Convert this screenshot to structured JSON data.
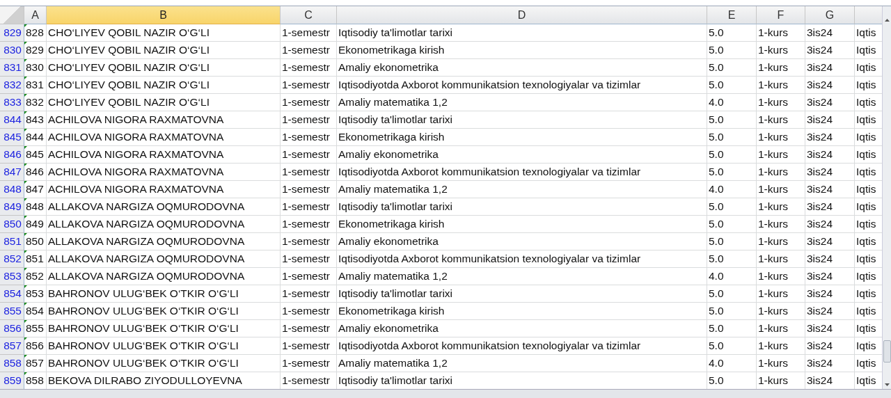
{
  "columns": [
    {
      "label": "A",
      "selected": false
    },
    {
      "label": "B",
      "selected": true
    },
    {
      "label": "C",
      "selected": false
    },
    {
      "label": "D",
      "selected": false
    },
    {
      "label": "E",
      "selected": false
    },
    {
      "label": "F",
      "selected": false
    },
    {
      "label": "G",
      "selected": false
    },
    {
      "selected": false
    }
  ],
  "rows": [
    {
      "row": "829",
      "cells": [
        "828",
        "CHO‘LIYEV QOBIL NAZIR O‘G‘LI",
        "1-semestr",
        "Iqtisodiy ta'limotlar tarixi",
        "5.0",
        "1-kurs",
        "3is24",
        "Iqtis"
      ]
    },
    {
      "row": "830",
      "cells": [
        "829",
        "CHO‘LIYEV QOBIL NAZIR O‘G‘LI",
        "1-semestr",
        "Ekonometrikaga kirish",
        "5.0",
        "1-kurs",
        "3is24",
        "Iqtis"
      ]
    },
    {
      "row": "831",
      "cells": [
        "830",
        "CHO‘LIYEV QOBIL NAZIR O‘G‘LI",
        "1-semestr",
        "Amaliy ekonometrika",
        "5.0",
        "1-kurs",
        "3is24",
        "Iqtis"
      ]
    },
    {
      "row": "832",
      "cells": [
        "831",
        "CHO‘LIYEV QOBIL NAZIR O‘G‘LI",
        "1-semestr",
        "Iqtisodiyotda Axborot kommunikatsion texnologiyalar va tizimlar",
        "5.0",
        "1-kurs",
        "3is24",
        "Iqtis"
      ]
    },
    {
      "row": "833",
      "cells": [
        "832",
        "CHO‘LIYEV QOBIL NAZIR O‘G‘LI",
        "1-semestr",
        "Amaliy matematika 1,2",
        "4.0",
        "1-kurs",
        "3is24",
        "Iqtis"
      ]
    },
    {
      "row": "844",
      "cells": [
        "843",
        "ACHILOVA NIGORA RAXMATOVNA",
        "1-semestr",
        "Iqtisodiy ta'limotlar tarixi",
        "5.0",
        "1-kurs",
        "3is24",
        "Iqtis"
      ]
    },
    {
      "row": "845",
      "cells": [
        "844",
        "ACHILOVA NIGORA RAXMATOVNA",
        "1-semestr",
        "Ekonometrikaga kirish",
        "5.0",
        "1-kurs",
        "3is24",
        "Iqtis"
      ]
    },
    {
      "row": "846",
      "cells": [
        "845",
        "ACHILOVA NIGORA RAXMATOVNA",
        "1-semestr",
        "Amaliy ekonometrika",
        "5.0",
        "1-kurs",
        "3is24",
        "Iqtis"
      ]
    },
    {
      "row": "847",
      "cells": [
        "846",
        "ACHILOVA NIGORA RAXMATOVNA",
        "1-semestr",
        "Iqtisodiyotda Axborot kommunikatsion texnologiyalar va tizimlar",
        "5.0",
        "1-kurs",
        "3is24",
        "Iqtis"
      ]
    },
    {
      "row": "848",
      "cells": [
        "847",
        "ACHILOVA NIGORA RAXMATOVNA",
        "1-semestr",
        "Amaliy matematika 1,2",
        "4.0",
        "1-kurs",
        "3is24",
        "Iqtis"
      ]
    },
    {
      "row": "849",
      "cells": [
        "848",
        "ALLAKOVA NARGIZA OQMURODOVNA",
        "1-semestr",
        "Iqtisodiy ta'limotlar tarixi",
        "5.0",
        "1-kurs",
        "3is24",
        "Iqtis"
      ]
    },
    {
      "row": "850",
      "cells": [
        "849",
        "ALLAKOVA NARGIZA OQMURODOVNA",
        "1-semestr",
        "Ekonometrikaga kirish",
        "5.0",
        "1-kurs",
        "3is24",
        "Iqtis"
      ]
    },
    {
      "row": "851",
      "cells": [
        "850",
        "ALLAKOVA NARGIZA OQMURODOVNA",
        "1-semestr",
        "Amaliy ekonometrika",
        "5.0",
        "1-kurs",
        "3is24",
        "Iqtis"
      ]
    },
    {
      "row": "852",
      "cells": [
        "851",
        "ALLAKOVA NARGIZA OQMURODOVNA",
        "1-semestr",
        "Iqtisodiyotda Axborot kommunikatsion texnologiyalar va tizimlar",
        "5.0",
        "1-kurs",
        "3is24",
        "Iqtis"
      ]
    },
    {
      "row": "853",
      "cells": [
        "852",
        "ALLAKOVA NARGIZA OQMURODOVNA",
        "1-semestr",
        "Amaliy matematika 1,2",
        "4.0",
        "1-kurs",
        "3is24",
        "Iqtis"
      ]
    },
    {
      "row": "854",
      "cells": [
        "853",
        "BAHRONOV ULUG‘BEK O‘TKIR O‘G‘LI",
        "1-semestr",
        "Iqtisodiy ta'limotlar tarixi",
        "5.0",
        "1-kurs",
        "3is24",
        "Iqtis"
      ]
    },
    {
      "row": "855",
      "cells": [
        "854",
        "BAHRONOV ULUG‘BEK O‘TKIR O‘G‘LI",
        "1-semestr",
        "Ekonometrikaga kirish",
        "5.0",
        "1-kurs",
        "3is24",
        "Iqtis"
      ]
    },
    {
      "row": "856",
      "cells": [
        "855",
        "BAHRONOV ULUG‘BEK O‘TKIR O‘G‘LI",
        "1-semestr",
        "Amaliy ekonometrika",
        "5.0",
        "1-kurs",
        "3is24",
        "Iqtis"
      ]
    },
    {
      "row": "857",
      "cells": [
        "856",
        "BAHRONOV ULUG‘BEK O‘TKIR O‘G‘LI",
        "1-semestr",
        "Iqtisodiyotda Axborot kommunikatsion texnologiyalar va tizimlar",
        "5.0",
        "1-kurs",
        "3is24",
        "Iqtis"
      ]
    },
    {
      "row": "858",
      "cells": [
        "857",
        "BAHRONOV ULUG‘BEK O‘TKIR O‘G‘LI",
        "1-semestr",
        "Amaliy matematika 1,2",
        "4.0",
        "1-kurs",
        "3is24",
        "Iqtis"
      ]
    },
    {
      "row": "859",
      "cells": [
        "858",
        "BEKOVA DILRABO ZIYODULLOYEVNA",
        "1-semestr",
        "Iqtisodiy ta'limotlar tarixi",
        "5.0",
        "1-kurs",
        "3is24",
        "Iqtis"
      ]
    }
  ]
}
